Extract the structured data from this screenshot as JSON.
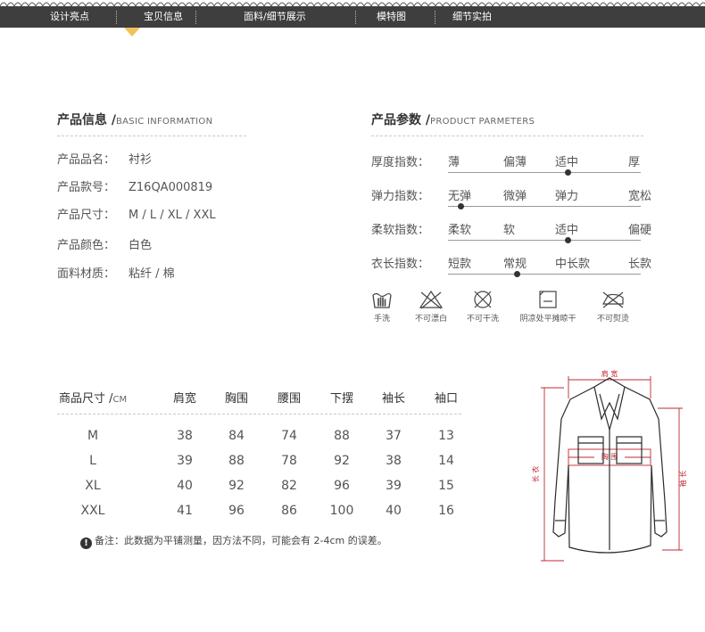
{
  "nav": {
    "items": [
      "设计亮点",
      "宝贝信息",
      "面料/细节展示",
      "模特图",
      "细节实拍"
    ],
    "active_index": 1,
    "bar_color": "#3e3e3e",
    "indicator_color": "#f3c05a"
  },
  "basic": {
    "title": "产品信息 /",
    "subtitle": "BASIC INFORMATION",
    "rows": [
      {
        "label": "产品品名：",
        "value": "衬衫"
      },
      {
        "label": "产品款号：",
        "value": "Z16QA000819"
      },
      {
        "label": "产品尺寸：",
        "value": "M / L / XL / XXL"
      },
      {
        "label": "产品颜色：",
        "value": "白色"
      },
      {
        "label": "面料材质：",
        "value": "粘纤 / 棉"
      }
    ]
  },
  "params": {
    "title": "产品参数 /",
    "subtitle": "PRODUCT PARMETERS",
    "rows": [
      {
        "label": "厚度指数：",
        "options": [
          "薄",
          "偏薄",
          "适中",
          "厚"
        ],
        "selected": 2
      },
      {
        "label": "弹力指数：",
        "options": [
          "无弹",
          "微弹",
          "弹力",
          "宽松"
        ],
        "selected": 0
      },
      {
        "label": "柔软指数：",
        "options": [
          "柔软",
          "软",
          "适中",
          "偏硬"
        ],
        "selected": 2
      },
      {
        "label": "衣长指数：",
        "options": [
          "短款",
          "常规",
          "中长款",
          "长款"
        ],
        "selected": 1
      }
    ]
  },
  "care": [
    {
      "icon": "hand-wash-icon",
      "label": "手洗"
    },
    {
      "icon": "no-bleach-icon",
      "label": "不可漂白"
    },
    {
      "icon": "no-dry-clean-icon",
      "label": "不可干洗"
    },
    {
      "icon": "shade-dry-icon",
      "label": "阴凉处平摊晾干"
    },
    {
      "icon": "no-iron-icon",
      "label": "不可熨烫"
    }
  ],
  "size_table": {
    "title": "商品尺寸 /",
    "unit": "CM",
    "headers": [
      "肩宽",
      "胸围",
      "腰围",
      "下摆",
      "袖长",
      "袖口"
    ],
    "rows": [
      {
        "size": "M",
        "values": [
          "38",
          "84",
          "74",
          "88",
          "37",
          "13"
        ]
      },
      {
        "size": "L",
        "values": [
          "39",
          "88",
          "78",
          "92",
          "38",
          "14"
        ]
      },
      {
        "size": "XL",
        "values": [
          "40",
          "92",
          "82",
          "96",
          "39",
          "15"
        ]
      },
      {
        "size": "XXL",
        "values": [
          "41",
          "96",
          "86",
          "100",
          "40",
          "16"
        ]
      }
    ],
    "note": "备注：此数据为平铺测量，因方法不同，可能会有 2-4cm 的误差。"
  },
  "diagram": {
    "shoulder_label": "肩 宽",
    "chest_label": "胸 围",
    "length_label": "长 衣",
    "sleeve_label": "袖 长",
    "measure_color": "#c0282f"
  }
}
